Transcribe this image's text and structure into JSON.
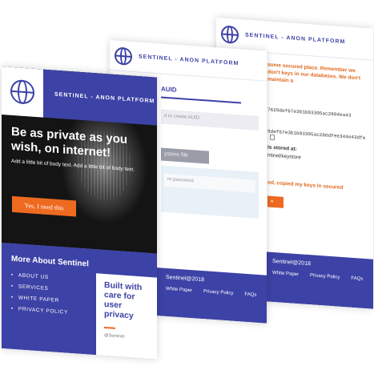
{
  "brand": "SENTINEL - ANON PLATFORM",
  "back_page": {
    "warning_top": "some secured place. Remember we don't keys in our databases. We don't maintain a",
    "hash_1": "7629def67e3b1b03305ac2604ea43",
    "hash_2": "9def67e3b1b03305ac260dfee344e43dfe",
    "stored_label": "is stored at:",
    "stored_path": "ntinel/keystore",
    "warning_bottom": "od, copied my keys in secured",
    "footer_copyright": "Sentinel@2018",
    "footer_links": [
      "White Paper",
      "Privacy Policy",
      "FAQs"
    ]
  },
  "middle_page": {
    "heading": "AUID",
    "create_placeholder": "d to create AUID",
    "keystore_button": "ystore file",
    "password_placeholder": "re password",
    "footer_copyright": "Sentinel@2018",
    "footer_links": [
      "White Paper",
      "Privacy Policy",
      "FAQs"
    ]
  },
  "front_page": {
    "headline": "Be as private as you wish, on internet!",
    "subtext": "Add a little bit of body text. Add a little bit of body text.",
    "cta_label": "Yes, I need this",
    "more_title": "More About Sentinel",
    "menu": [
      "ABOUT US",
      "SERVICES",
      "WHITE PAPER",
      "PRIVACY POLICY"
    ],
    "card_title": "Built with care for user privacy",
    "card_tag": "@Sentinel"
  },
  "colors": {
    "primary": "#3d42a6",
    "accent": "#ee6a20"
  }
}
